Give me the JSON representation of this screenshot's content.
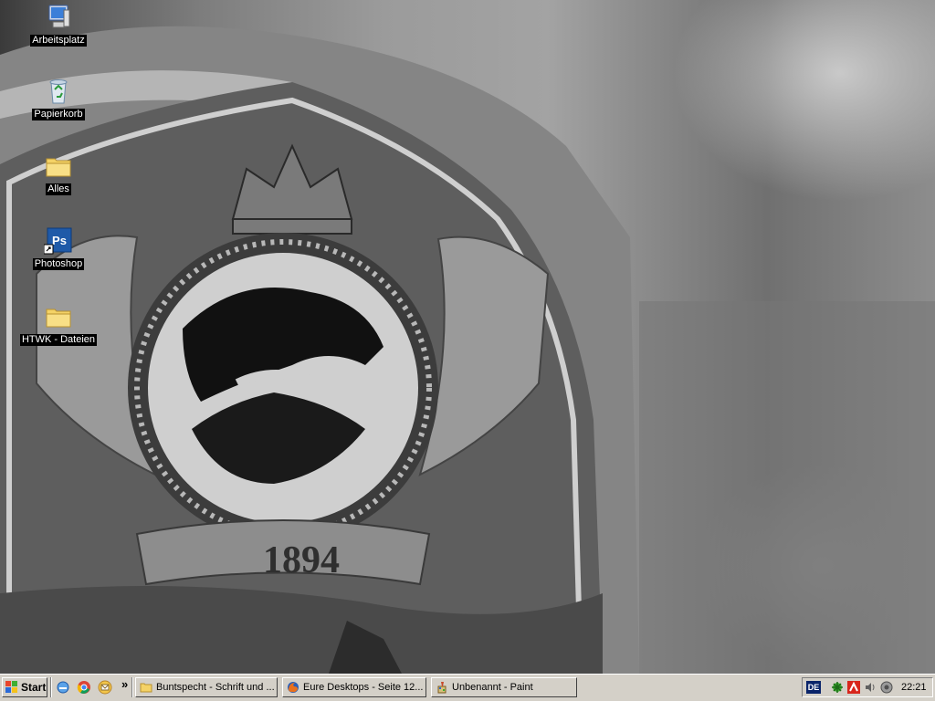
{
  "desktop": {
    "icons": [
      {
        "label": "Arbeitsplatz",
        "icon": "my-computer-icon"
      },
      {
        "label": "Papierkorb",
        "icon": "recycle-bin-icon"
      },
      {
        "label": "Alles",
        "icon": "folder-icon"
      },
      {
        "label": "Photoshop",
        "icon": "photoshop-icon",
        "badge": "Ps"
      },
      {
        "label": "HTWK - Dateien",
        "icon": "folder-icon"
      }
    ],
    "wallpaper": {
      "emblem_year": "1894",
      "style": "grayscale"
    }
  },
  "taskbar": {
    "start_label": "Start",
    "quick_launch": [
      "internet-explorer-icon",
      "chrome-icon",
      "mail-icon"
    ],
    "chevron": "»",
    "tasks": [
      {
        "label": "Buntspecht - Schrift und ...",
        "icon": "folder-icon"
      },
      {
        "label": "Eure Desktops - Seite 12...",
        "icon": "firefox-icon"
      },
      {
        "label": "Unbenannt - Paint",
        "icon": "paint-icon"
      }
    ],
    "tray": {
      "language": "DE",
      "icons": [
        "network-icon",
        "antivirus-icon",
        "volume-icon",
        "update-icon"
      ],
      "clock": "22:21"
    }
  },
  "colors": {
    "taskbar": "#d4d0c8",
    "label_bg": "#000000",
    "label_fg": "#ffffff",
    "lang_bg": "#0a246a"
  }
}
